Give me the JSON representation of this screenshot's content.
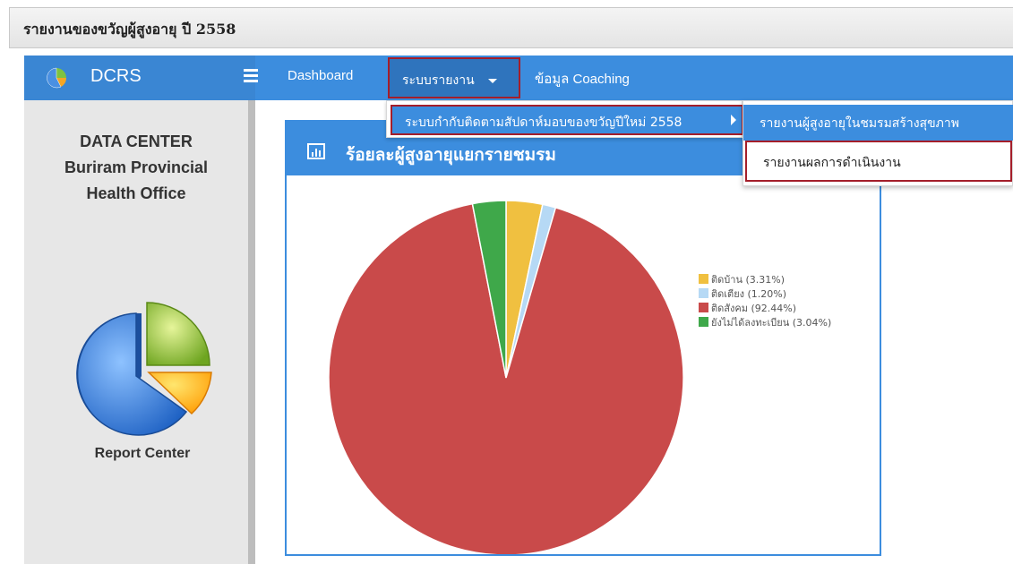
{
  "page": {
    "title": "รายงานของขวัญผู้สูงอายุ ปี 2558"
  },
  "navbar": {
    "brand": "DCRS",
    "items": [
      {
        "label": "Dashboard"
      },
      {
        "label": "ระบบรายงาน"
      },
      {
        "label": "ข้อมูล Coaching"
      }
    ]
  },
  "dropdown": {
    "level1_item": "ระบบกำกับติดตามสัปดาห์มอบของขวัญปีใหม่ 2558",
    "level2_items": [
      "รายงานผู้สูงอายุในชมรมสร้างสุขภาพ",
      "รายงานผลการดำเนินงาน"
    ]
  },
  "sidebar": {
    "title_lines": [
      "DATA CENTER",
      "Buriram Provincial",
      "Health Office"
    ],
    "caption": "Report Center"
  },
  "panel": {
    "title": "ร้อยละผู้สูงอายุแยกรายชมรม"
  },
  "colors": {
    "accent": "#3c8dde",
    "highlight_border": "#a41e2a"
  },
  "chart_data": {
    "type": "pie",
    "slices": [
      {
        "label": "ติดบ้าน (3.31%)",
        "value": 3.31,
        "color": "#f0c040"
      },
      {
        "label": "ติดเตียง (1.20%)",
        "value": 1.2,
        "color": "#b6d9f5"
      },
      {
        "label": "ติดสังคม (92.44%)",
        "value": 92.44,
        "color": "#c94a4a"
      },
      {
        "label": "ยังไม่ได้ลงทะเบียน (3.04%)",
        "value": 3.04,
        "color": "#3fa84a"
      }
    ],
    "legend_position": "top-right"
  }
}
